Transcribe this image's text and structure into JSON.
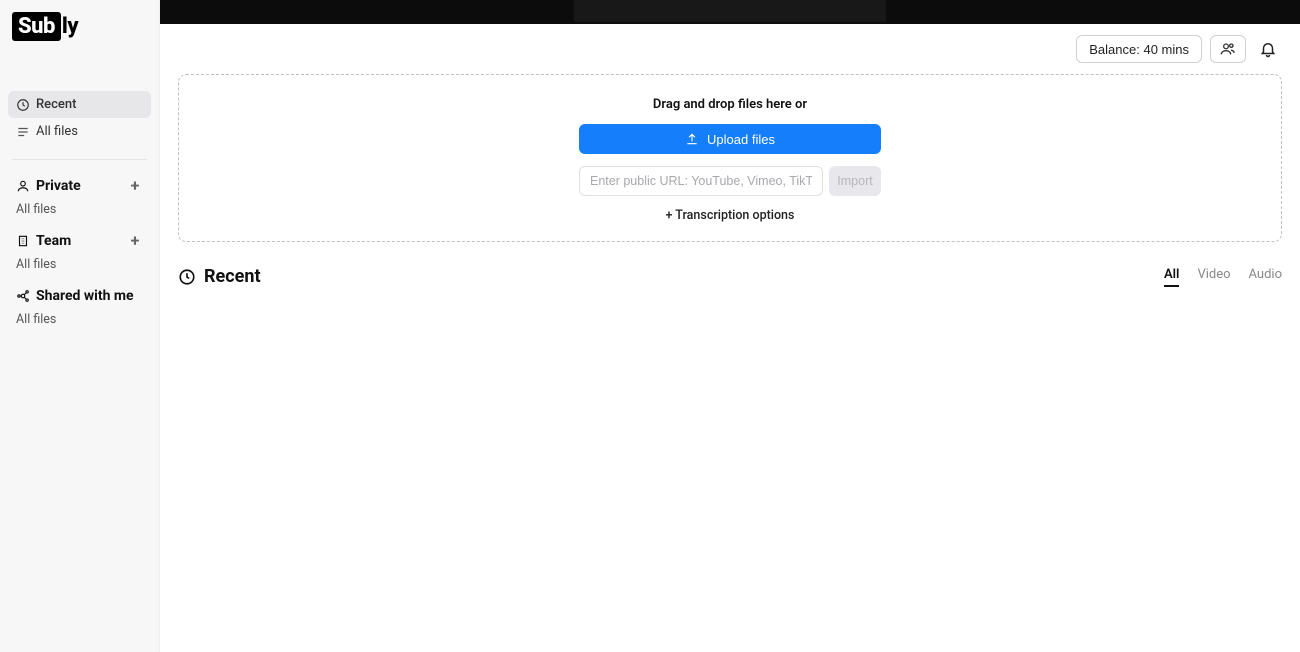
{
  "logo": {
    "part1": "Sub",
    "part2": "ly"
  },
  "sidebar": {
    "recent_label": "Recent",
    "all_files_label": "All files",
    "private": {
      "label": "Private",
      "all_files": "All files"
    },
    "team": {
      "label": "Team",
      "all_files": "All files"
    },
    "shared": {
      "label": "Shared with me",
      "all_files": "All files"
    }
  },
  "header": {
    "balance": "Balance: 40 mins"
  },
  "dropzone": {
    "drag_text": "Drag and drop files here or",
    "upload_label": "Upload files",
    "url_placeholder": "Enter public URL: YouTube, Vimeo, TikTok...",
    "import_label": "Import",
    "options_label": "+ Transcription options"
  },
  "recent": {
    "title": "Recent",
    "tabs": {
      "all": "All",
      "video": "Video",
      "audio": "Audio"
    }
  }
}
